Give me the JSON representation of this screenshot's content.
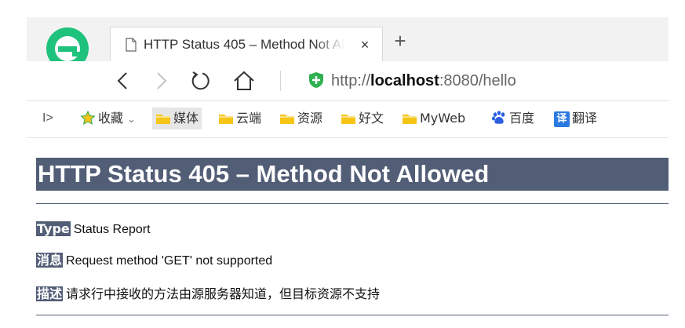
{
  "tab": {
    "title": "HTTP Status 405 – Method Not Allowed",
    "close_glyph": "×",
    "new_tab_glyph": "+"
  },
  "address": {
    "scheme": "http://",
    "host": "localhost",
    "rest": ":8080/hello"
  },
  "bookmarks": {
    "expand_glyph": "I>",
    "items": [
      {
        "label": "收藏",
        "icon": "star-icon",
        "suffix": "⌄"
      },
      {
        "label": "媒体",
        "icon": "folder-icon"
      },
      {
        "label": "云端",
        "icon": "folder-icon"
      },
      {
        "label": "资源",
        "icon": "folder-icon"
      },
      {
        "label": "好文",
        "icon": "folder-icon"
      },
      {
        "label": "MyWeb",
        "icon": "folder-icon"
      },
      {
        "label": "百度",
        "icon": "paw-icon"
      },
      {
        "label": "翻译",
        "icon": "translate-icon",
        "badge": "译"
      }
    ]
  },
  "page": {
    "heading": "HTTP Status 405 – Method Not Allowed",
    "rows": [
      {
        "key": "Type",
        "value": "Status Report"
      },
      {
        "key": "消息",
        "value": "Request method 'GET' not supported"
      },
      {
        "key": "描述",
        "value": "请求行中接收的方法由源服务器知道，但目标资源不支持"
      }
    ]
  },
  "colors": {
    "heading_bg": "#525d76",
    "folder": "#f5c518",
    "shield": "#2fb14f",
    "logo": "#1ec27c"
  }
}
